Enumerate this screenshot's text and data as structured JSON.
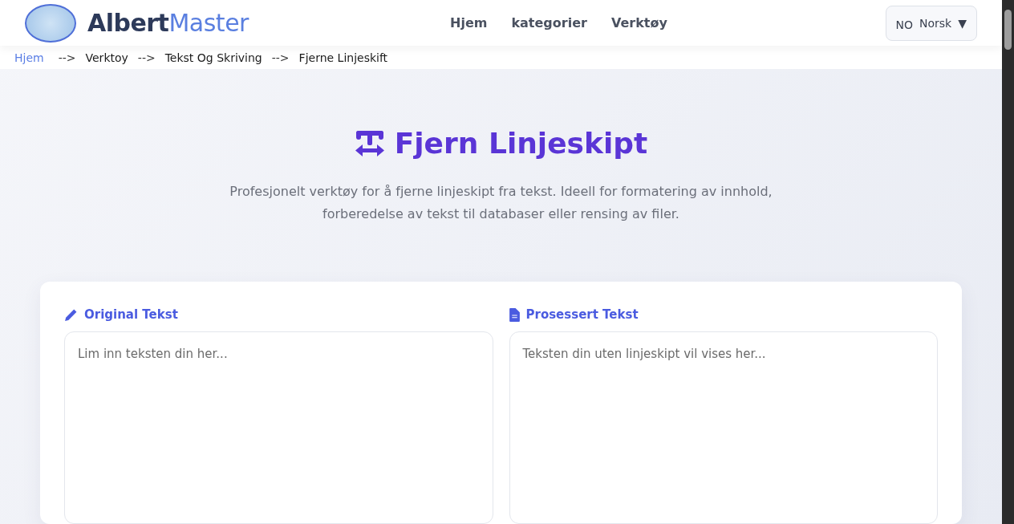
{
  "header": {
    "logo_parts": [
      "Albert",
      "Master"
    ],
    "nav": [
      {
        "label": "Hjem"
      },
      {
        "label": "kategorier"
      },
      {
        "label": "Verktøy"
      }
    ],
    "language": {
      "code": "NO",
      "name": "Norsk",
      "caret": "▼"
    }
  },
  "breadcrumb": [
    {
      "label": "Hjem",
      "kind": "link"
    },
    {
      "label": "-->",
      "kind": "separator"
    },
    {
      "label": "Verktoy",
      "kind": "crumb"
    },
    {
      "label": "-->",
      "kind": "separator"
    },
    {
      "label": "Tekst Og Skriving",
      "kind": "crumb"
    },
    {
      "label": "-->",
      "kind": "separator"
    },
    {
      "label": "Fjerne Linjeskift",
      "kind": "crumb"
    }
  ],
  "hero": {
    "title": "Fjern Linjeskipt",
    "description": "Profesjonelt verktøy for å fjerne linjeskipt fra tekst. Ideell for formatering av innhold, forberedelse av tekst til databaser eller rensing av filer."
  },
  "panels": [
    {
      "kind": "input",
      "label": "Original Tekst",
      "placeholder": "Lim inn teksten din her..."
    },
    {
      "kind": "output",
      "label": "Prosessert Tekst",
      "placeholder": "Teksten din uten linjeskipt vil vises her..."
    }
  ]
}
